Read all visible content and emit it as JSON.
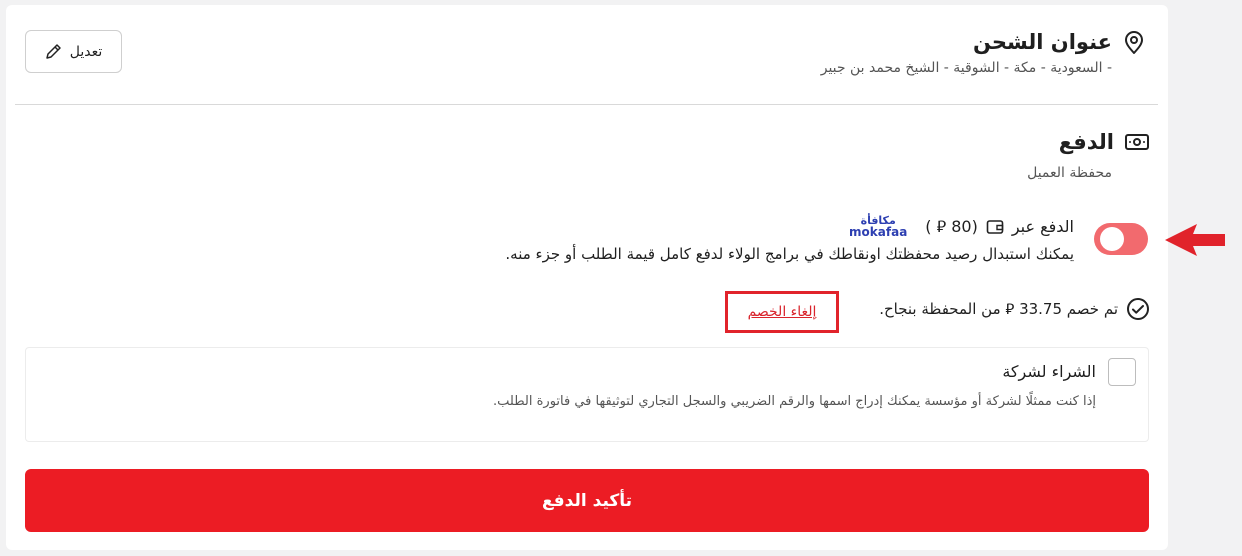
{
  "shipping": {
    "title": "عنوان الشحن",
    "address": "- السعودية - مكة - الشوقية - الشيخ محمد بن جبير",
    "edit_label": "تعديل",
    "icon": "location-pin-icon"
  },
  "payment": {
    "title": "الدفع",
    "subtitle": "محفظة العميل",
    "icon": "cash-icon",
    "wallet": {
      "pay_via_label": "الدفع عبر",
      "balance_text": "(80 ⃁ )",
      "brand_ar": "مكافأة",
      "brand_en": "mokafaa",
      "description": "يمكنك استبدال رصيد محفظتك اونقاطك في برامج الولاء لدفع كامل قيمة الطلب أو جزء منه.",
      "toggle_on": true,
      "status_text": "تم خصم 33.75 ⃁ من المحفظة بنجاح.",
      "cancel_label": "إلغاء الخصم"
    }
  },
  "company": {
    "label": "الشراء لشركة",
    "description": "إذا كنت ممثلًا لشركة أو مؤسسة يمكنك إدراج اسمها والرقم الضريبي والسجل التجاري لتوثيقها في فاتورة الطلب.",
    "checked": false
  },
  "confirm_label": "تأكيد الدفع",
  "colors": {
    "accent": "#ec1c24",
    "toggle": "#f26a6e",
    "brand": "#2d3fb1"
  }
}
